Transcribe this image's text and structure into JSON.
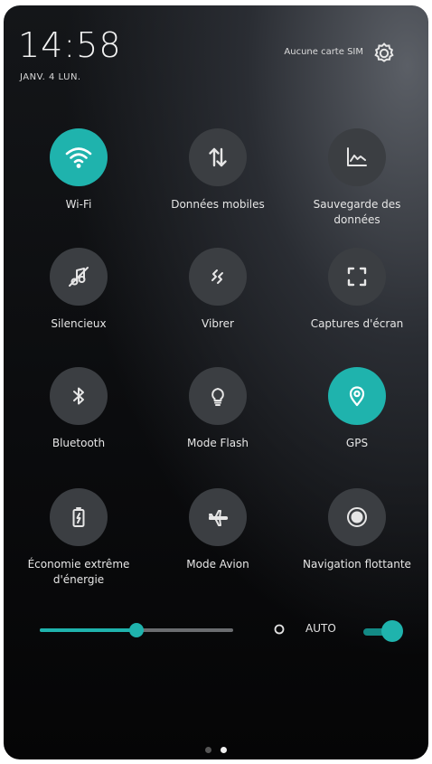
{
  "status": {
    "time": "14:58",
    "date": "JANV. 4 LUN.",
    "sim": "Aucune carte SIM"
  },
  "tiles": [
    {
      "label": "Wi-Fi",
      "icon": "wifi-icon",
      "active": true
    },
    {
      "label": "Données mobiles",
      "icon": "mobile-data-icon",
      "active": false
    },
    {
      "label": "Sauvegarde des données",
      "icon": "data-saver-icon",
      "active": false
    },
    {
      "label": "Silencieux",
      "icon": "silent-icon",
      "active": false
    },
    {
      "label": "Vibrer",
      "icon": "vibrate-icon",
      "active": false
    },
    {
      "label": "Captures d'écran",
      "icon": "screenshot-icon",
      "active": false
    },
    {
      "label": "Bluetooth",
      "icon": "bluetooth-icon",
      "active": false
    },
    {
      "label": "Mode Flash",
      "icon": "flashlight-icon",
      "active": false
    },
    {
      "label": "GPS",
      "icon": "gps-icon",
      "active": true
    },
    {
      "label": "Économie extrême d'énergie",
      "icon": "battery-saver-icon",
      "active": false
    },
    {
      "label": "Mode Avion",
      "icon": "airplane-icon",
      "active": false
    },
    {
      "label": "Navigation flottante",
      "icon": "floating-navigation-icon",
      "active": false
    }
  ],
  "brightness": {
    "level": 0.5,
    "auto_label": "AUTO",
    "auto_on": true
  },
  "pages": {
    "count": 2,
    "current": 2
  },
  "colors": {
    "accent": "#1fb3ad",
    "tile_inactive": "#3b3e42"
  }
}
